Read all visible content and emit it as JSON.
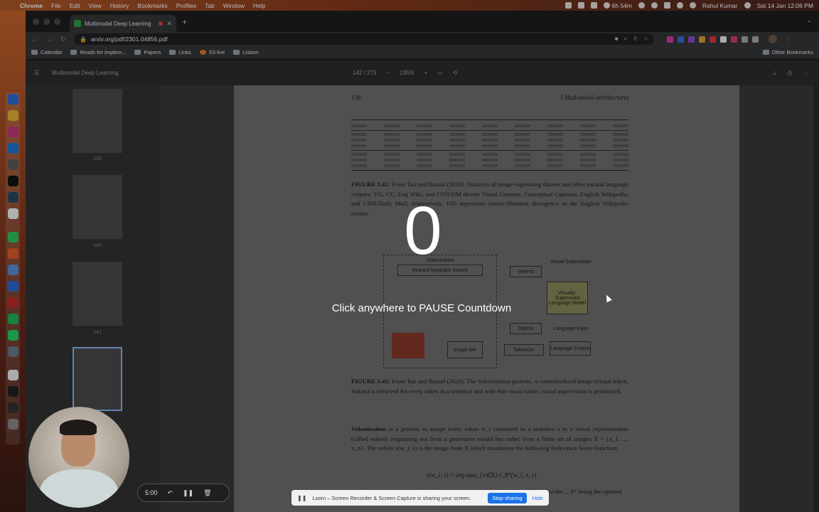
{
  "menubar": {
    "app": "Chrome",
    "items": [
      "File",
      "Edit",
      "View",
      "History",
      "Bookmarks",
      "Profiles",
      "Tab",
      "Window",
      "Help"
    ],
    "timer": "6h 54m",
    "user": "Rahul Kumar",
    "datetime": "Sat 14 Jan  12:06 PM"
  },
  "browser": {
    "tab_title": "Multimodal Deep Learning",
    "url": "arxiv.org/pdf/2301.04856.pdf",
    "bookmarks": [
      "Calendar",
      "Reads for implem...",
      "Papers",
      "Links",
      "S3 live",
      "Lisbon"
    ],
    "other_bookmarks": "Other Bookmarks"
  },
  "pdf": {
    "title": "Multimodal Deep Learning",
    "page_indicator": "142 / 273",
    "zoom": "135%",
    "thumbnail_numbers": [
      "139",
      "140",
      "141",
      "142"
    ],
    "page_number": "136",
    "chapter": "3 Multimodal architectures",
    "fig42_label": "FIGURE 3.42:",
    "fig42_cite": "Tan and Bansal (2020)",
    "fig42_text": "From Tan and Bansal (2020). Statistics of image-captioning dataset and other natural language corpora. VG, CC, Eng Wiki, and CNN/DM denote Visual Genome, Conceptual Captions, English Wikipedia, and CNN/Daily Mail, respectively. JSD represents Jensen-Shannon divergence to the English Wikipedia corpus.",
    "diagram": {
      "title": "Vokenization",
      "nn_search": "Nearest Neighbor Search",
      "vokens": "Vokens",
      "visual_supervision": "Visual Supervision",
      "model": "Visually-Supervised Language Model",
      "tokens": "Tokens",
      "language_input": "Language Input",
      "tokenizer": "Tokenizer",
      "language_corpus": "Language Corpus",
      "image_set": "Image Set"
    },
    "fig43_label": "FIGURE 3.43:",
    "fig43_text": "From Tan and Bansal (2020). The Vokenization process. A contextualized image (visual token, Voken) is retrieved for every token in a sentence and with this visual token, visual supervision is performed.",
    "body_term": "Vokenization",
    "body_text": "is a process to assign every token w_i contained in a sentence s to a visual representation (called voken) originating not from a generative model but rather from a finite set of images X = {x_1, ..., x_n}. The voken v(w_i; s) is the image from X which maximizes the following Relevance Score Function:",
    "formula": "v(w_i; s) = arg max_{x∈X} r_θ*(w_i, x, s)",
    "body_tail": "itself, but also the ... θ* being the optimal"
  },
  "overlay": {
    "countdown": "0",
    "hint": "Click anywhere to PAUSE Countdown"
  },
  "loom": {
    "time": "5:00",
    "share_message": "Loom – Screen Recorder & Screen Capture is sharing your screen.",
    "stop_label": "Stop sharing",
    "hide_label": "Hide"
  },
  "colors": {
    "accent": "#1a73e8",
    "record_red": "#e04545",
    "favicon_green": "#2e9e3e"
  }
}
